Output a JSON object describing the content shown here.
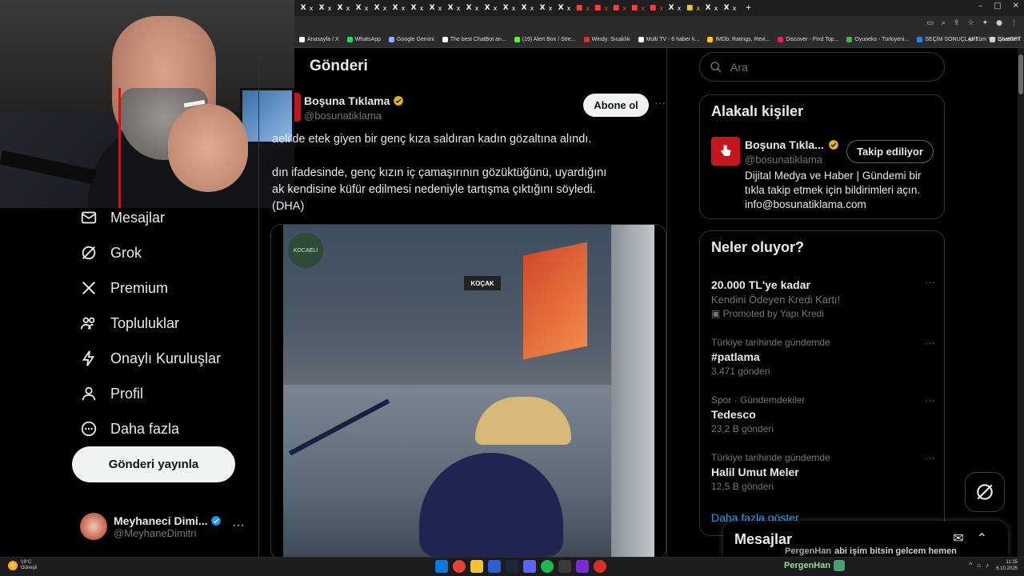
{
  "browser": {
    "tab_glyph": "X",
    "tab_close": "x",
    "bookmarks": [
      {
        "label": "Anasayfa / X",
        "color": "#ffffff"
      },
      {
        "label": "WhatsApp",
        "color": "#25d366"
      },
      {
        "label": "Google Gemini",
        "color": "#8ab4f8"
      },
      {
        "label": "The best ChatBot an...",
        "color": "#ffffff"
      },
      {
        "label": "(19) Alert Box / Stre...",
        "color": "#53fc18"
      },
      {
        "label": "Windy: Sıcaklık",
        "color": "#d93025"
      },
      {
        "label": "Multi TV - 6 haber k...",
        "color": "#ffffff"
      },
      {
        "label": "IMDb: Ratings, Revi...",
        "color": "#f5c518"
      },
      {
        "label": "Discover - Find Top...",
        "color": "#e91e63"
      },
      {
        "label": "Oyuneks - Türkiyeni...",
        "color": "#4caf50"
      },
      {
        "label": "SEÇİM SONUÇLARI...",
        "color": "#1e88e5"
      },
      {
        "label": "ChatGPT",
        "color": "#cccccc"
      }
    ],
    "bookmarks_more": "»",
    "all_bookmarks": "Tüm Yer İşaretleri"
  },
  "sidebar": {
    "items": [
      {
        "label": "Mesajlar",
        "icon": "mail-icon"
      },
      {
        "label": "Grok",
        "icon": "grok-icon"
      },
      {
        "label": "Premium",
        "icon": "x-logo-icon"
      },
      {
        "label": "Topluluklar",
        "icon": "communities-icon"
      },
      {
        "label": "Onaylı Kuruluşlar",
        "icon": "lightning-icon"
      },
      {
        "label": "Profil",
        "icon": "person-icon"
      },
      {
        "label": "Daha fazla",
        "icon": "more-circle-icon"
      }
    ],
    "post_button": "Gönderi yayınla",
    "account": {
      "name": "Meyhaneci Dimi...",
      "handle": "@MeyhaneDimitri",
      "more": "···"
    }
  },
  "main": {
    "header": "Gönderi",
    "post": {
      "author": "Boşuna Tıklama",
      "handle": "@bosunatiklama",
      "subscribe": "Abone ol",
      "more": "···",
      "text_lines": [
        "aeli'de etek giyen bir genç kıza saldıran kadın gözaltına alındı.",
        "dın ifadesinde, genç kızın iç çamaşırının gözüktüğünü, uyardığını",
        "ak kendisine küfür edilmesi nedeniyle tartışma çıktığını söyledi.",
        "(DHA)"
      ],
      "video_logo": "KOCAELİ",
      "video_sign": "KOÇAK"
    }
  },
  "right": {
    "search_placeholder": "Ara",
    "related": {
      "title": "Alakalı kişiler",
      "name": "Boşuna Tıkla...",
      "handle": "@bosunatiklama",
      "follow": "Takip ediliyor",
      "bio": "Dijital Medya ve Haber | Gündemi bir tıkla takip etmek için bildirimleri açın. info@bosunatiklama.com"
    },
    "trends": {
      "title": "Neler oluyor?",
      "items": [
        {
          "meta": "",
          "title": "20.000 TL'ye kadar",
          "sub": "Kendini Ödeyen Kredi Kartı!",
          "count": "Promoted by Yapı Kredi"
        },
        {
          "meta": "Türkiye tarihinde gündemde",
          "title": "#patlama",
          "sub": "",
          "count": "3.471 gönderi"
        },
        {
          "meta": "Spor · Gündemdekiler",
          "title": "Tedesco",
          "sub": "",
          "count": "23,2 B gönderi"
        },
        {
          "meta": "Türkiye tarihinde gündemde",
          "title": "Halil Umut Meler",
          "sub": "",
          "count": "12,5 B gönderi"
        }
      ],
      "more_glyph": "···",
      "show_more": "Daha fazla göster"
    }
  },
  "messages": {
    "title": "Mesajlar"
  },
  "stream_overlay": {
    "chat_name": "PergenHan",
    "chat_text": "abi işim bitsin gelcem hemen",
    "streamer_label": "PergenHan"
  },
  "taskbar": {
    "weather_temp": "19°C",
    "weather_desc": "Güneşli",
    "time": "11:15",
    "date": "6.10.2025"
  },
  "colors": {
    "accent": "#1d9bf0",
    "brand_red": "#c4161c",
    "verified_gold": "#e2b719",
    "verified_blue": "#1d9bf0"
  }
}
